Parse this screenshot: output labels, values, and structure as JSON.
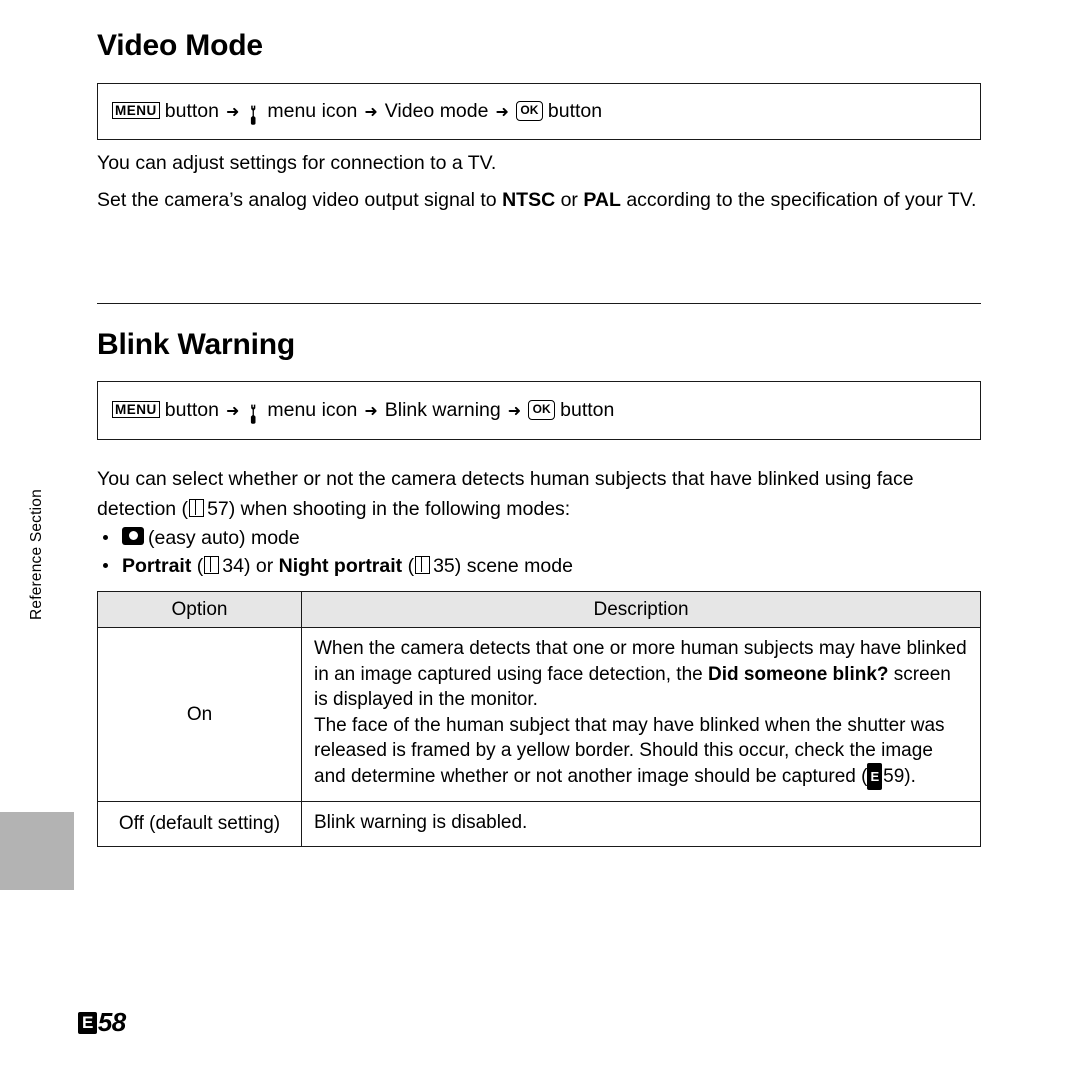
{
  "page": {
    "side_tab_label": "Reference Section",
    "footer_marker": "E",
    "footer_page": "58"
  },
  "sections": [
    {
      "heading": "Video Mode",
      "nav": {
        "menu_glyph": "MENU",
        "menu_button_label": "button",
        "arrow": "➜",
        "menu_icon_name": "wrench-icon",
        "menu_icon_label": "menu icon",
        "item_label": "Video mode",
        "ok_glyph": "OK",
        "ok_button_label": "button"
      },
      "paragraphs": [
        "You can adjust settings for connection to a TV.",
        "Set the camera’s analog video output signal to NTSC or PAL according to the specification of your TV."
      ]
    },
    {
      "heading": "Blink Warning",
      "nav": {
        "menu_glyph": "MENU",
        "menu_button_label": "button",
        "arrow": "➜",
        "menu_icon_name": "wrench-icon",
        "menu_icon_label": "menu icon",
        "item_label": "Blink warning",
        "ok_glyph": "OK",
        "ok_button_label": "button"
      },
      "intro_part1": "You can select whether or not the camera detects human subjects that have blinked using face detection (",
      "intro_ref1": "57",
      "intro_part2": ") when shooting in the following modes:",
      "bullets": [
        {
          "icon": "easy-auto-camera-icon",
          "text": "(easy auto) mode"
        },
        {
          "bold1": "Portrait",
          "ref1": "34",
          "mid": "or",
          "bold2": "Night portrait",
          "ref2": "35",
          "tail": "scene mode"
        }
      ]
    }
  ],
  "table": {
    "headers": [
      "Option",
      "Description"
    ],
    "rows": [
      {
        "option": "On",
        "description_lines": [
          "When the camera detects that one or more human subjects may have",
          "blinked in an image captured using face detection, the Did someone",
          "blink? screen is displayed in the monitor.",
          "The face of the human subject that may have blinked when the shutter",
          "was released is framed by a yellow border. Should this occur, check the",
          "image and determine whether or not another image should be captured",
          "(E59)."
        ],
        "bold_terms": [
          "Did someone blink?"
        ],
        "ref_marker": "E",
        "ref_page": "59"
      },
      {
        "option": "Off (default setting)",
        "description_lines": [
          "Blink warning is disabled."
        ]
      }
    ]
  }
}
